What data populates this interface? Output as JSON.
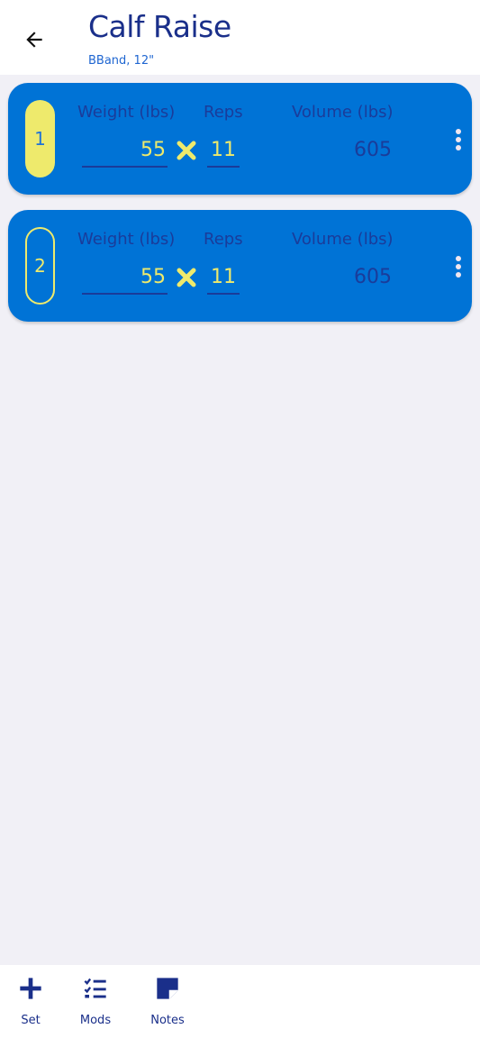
{
  "header": {
    "title": "Calf Raise",
    "subtitle": "BBand, 12\""
  },
  "columns": {
    "weight": "Weight (lbs)",
    "reps": "Reps",
    "volume": "Volume (lbs)"
  },
  "sets": [
    {
      "number": "1",
      "weight": "55",
      "reps": "11",
      "volume": "605",
      "badge_style": "filled"
    },
    {
      "number": "2",
      "weight": "55",
      "reps": "11",
      "volume": "605",
      "badge_style": "outline"
    }
  ],
  "bottom_bar": {
    "set_label": "Set",
    "mods_label": "Mods",
    "notes_label": "Notes"
  },
  "colors": {
    "card": "#0073d6",
    "accent_yellow": "#eeea6c",
    "dark_blue": "#1a2f8a",
    "background": "#f1f0f6"
  },
  "icons": [
    "back-arrow-icon",
    "times-icon",
    "more-vertical-icon",
    "plus-icon",
    "checklist-icon",
    "note-icon"
  ]
}
